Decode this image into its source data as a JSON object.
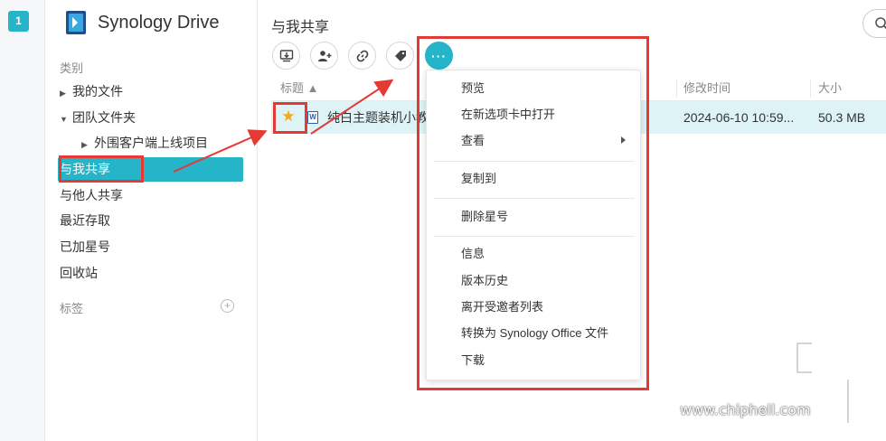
{
  "rail": {
    "badge": "1"
  },
  "sidebar": {
    "app_title": "Synology Drive",
    "section_label": "类别",
    "items": [
      {
        "label": "我的文件",
        "caret": "▶"
      },
      {
        "label": "团队文件夹",
        "caret": "▼"
      },
      {
        "label": "外围客户端上线项目",
        "caret": "▶"
      },
      {
        "label": "与我共享"
      },
      {
        "label": "与他人共享"
      },
      {
        "label": "最近存取"
      },
      {
        "label": "已加星号"
      },
      {
        "label": "回收站"
      }
    ],
    "tags_label": "标签",
    "add_tag": "+"
  },
  "main": {
    "title": "与我共享",
    "more_button": "···",
    "columns": {
      "title": "标题 ▲",
      "modified": "修改时间",
      "size": "大小"
    },
    "row": {
      "star": "★",
      "doc_icon_letter": "W",
      "name": "纯白主题装机小教",
      "modified": "2024-06-10 10:59...",
      "size": "50.3 MB"
    }
  },
  "context_menu": {
    "items": [
      "预览",
      "在新选项卡中打开",
      "查看",
      "复制到",
      "删除星号",
      "信息",
      "版本历史",
      "离开受邀者列表",
      "转换为 Synology Office 文件",
      "下载"
    ]
  },
  "watermark": {
    "url": "www.chiphell.com"
  },
  "colors": {
    "accent": "#26b5c8",
    "highlight": "#e53935",
    "star": "#f5a623"
  }
}
